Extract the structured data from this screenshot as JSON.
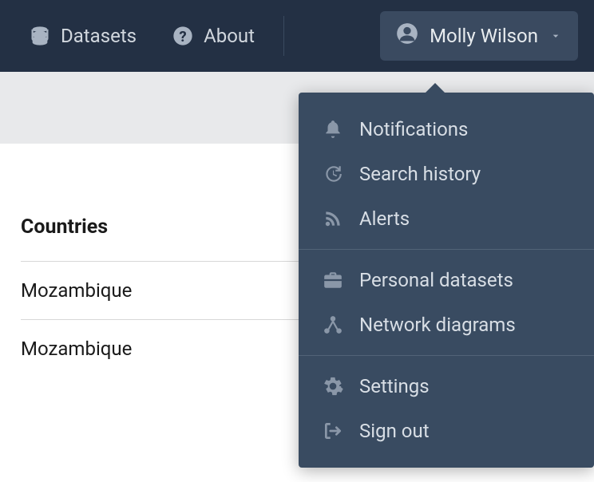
{
  "nav": {
    "datasets_label": "Datasets",
    "about_label": "About"
  },
  "user": {
    "name": "Molly Wilson"
  },
  "menu": {
    "notifications": "Notifications",
    "search_history": "Search history",
    "alerts": "Alerts",
    "personal_datasets": "Personal datasets",
    "network_diagrams": "Network diagrams",
    "settings": "Settings",
    "sign_out": "Sign out"
  },
  "content": {
    "section_title": "Countries",
    "items": [
      "Mozambique",
      "Mozambique"
    ]
  }
}
